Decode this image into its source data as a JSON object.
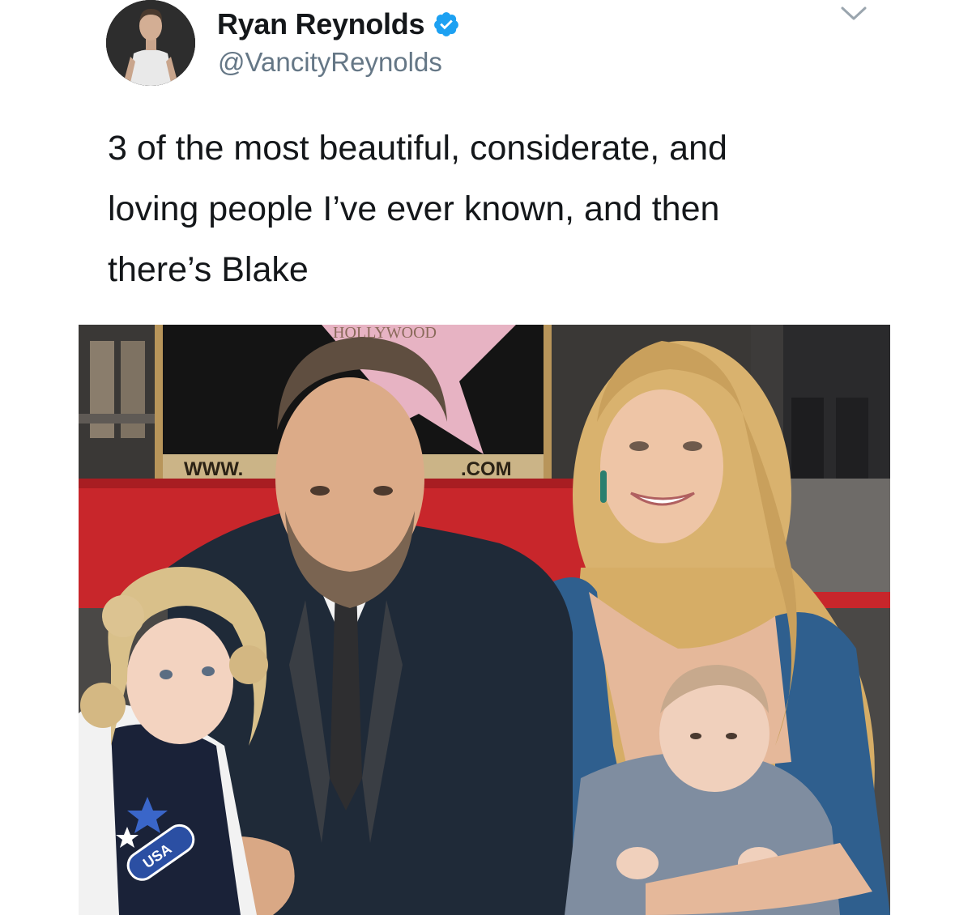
{
  "tweet": {
    "author": {
      "display_name": "Ryan Reynolds",
      "handle": "@VancityReynolds",
      "verified": true,
      "verified_color": "#1da1f2"
    },
    "text": "3 of the most beautiful, considerate, and\nloving people I’ve ever known, and then\nthere’s Blake",
    "menu_icon": "chevron-down-icon",
    "photo": {
      "sign_top": "HOLLYWOOD",
      "sign_left": "WWW.",
      "sign_right": ".COM",
      "patch_text": "USA"
    }
  },
  "colors": {
    "name": "#14171a",
    "handle": "#657786",
    "text": "#14171a",
    "red_carpet": "#c8262b",
    "star_pink": "#e7b3c3",
    "plaque_gold": "#b8955a"
  }
}
